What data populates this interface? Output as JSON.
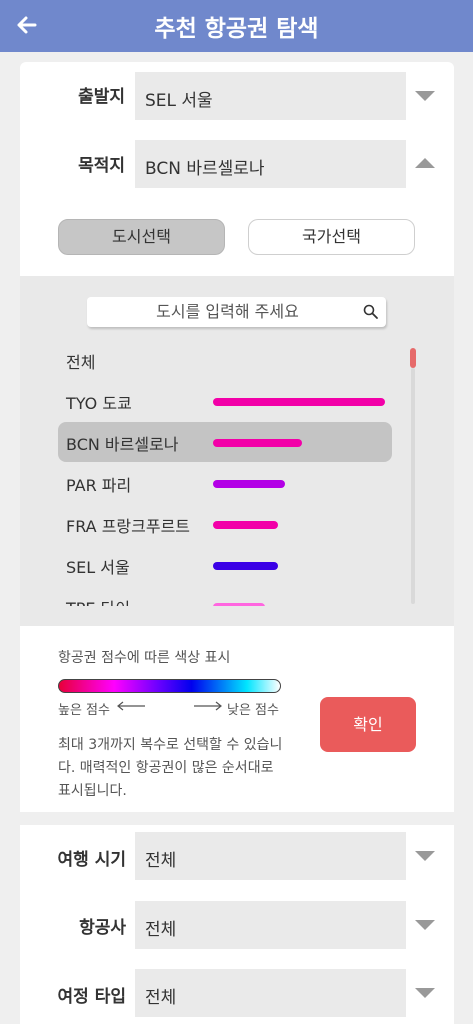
{
  "header": {
    "title": "추천 항공권 탐색",
    "back_icon": "back-arrow-icon"
  },
  "departure": {
    "label": "출발지",
    "value": "SEL 서울"
  },
  "destination": {
    "label": "목적지",
    "value": "BCN 바르셀로나"
  },
  "tabs": {
    "city": "도시선택",
    "country": "국가선택",
    "selected": "city"
  },
  "city_search": {
    "placeholder": "도시를 입력해 주세요"
  },
  "cities": [
    {
      "label": "전체",
      "score": null,
      "color": null
    },
    {
      "label": "TYO 도쿄",
      "score": 1.0,
      "color": "#f200a8"
    },
    {
      "label": "BCN 바르셀로나",
      "score": 0.52,
      "color": "#f200a8",
      "selected": true
    },
    {
      "label": "PAR 파리",
      "score": 0.42,
      "color": "#b300e6"
    },
    {
      "label": "FRA 프랑크푸르트",
      "score": 0.38,
      "color": "#f200a8"
    },
    {
      "label": "SEL 서울",
      "score": 0.38,
      "color": "#3a00e6"
    },
    {
      "label": "TPE 타이",
      "score": 0.3,
      "color": "#ff66e0"
    }
  ],
  "legend": {
    "title": "항공권 점수에 따른 색상 표시",
    "high": "높은 점수",
    "low": "낮은 점수",
    "note": "최대 3개까지 복수로 선택할 수 있습니다. 매력적인 항공권이 많은 순서대로 표시됩니다."
  },
  "confirm_label": "확인",
  "filters": [
    {
      "label": "여행 시기",
      "value": "전체"
    },
    {
      "label": "항공사",
      "value": "전체"
    },
    {
      "label": "여정 타입",
      "value": "전체"
    }
  ]
}
